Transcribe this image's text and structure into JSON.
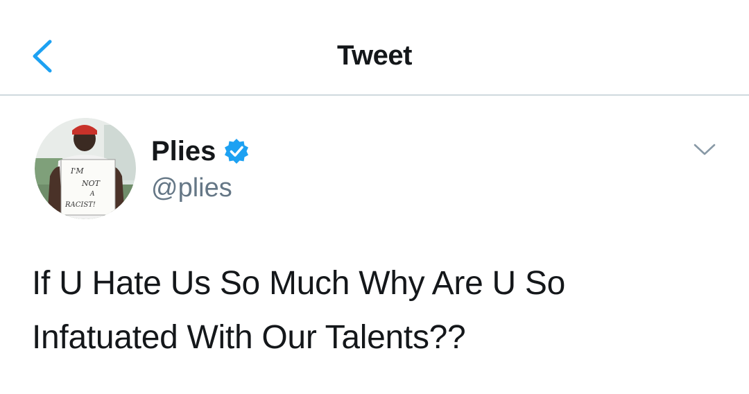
{
  "nav": {
    "title": "Tweet",
    "back_icon": "chevron-left-icon",
    "accent_color": "#1da1f2"
  },
  "tweet": {
    "author": {
      "name": "Plies",
      "handle": "@plies",
      "verified": true,
      "verified_icon": "verified-badge-icon",
      "avatar_sign": [
        "I'M",
        "NOT",
        "A",
        "RACIST!"
      ]
    },
    "more_icon": "chevron-down-icon",
    "text": "If U Hate Us So Much Why Are U So\nInfatuated With Our Talents??"
  }
}
